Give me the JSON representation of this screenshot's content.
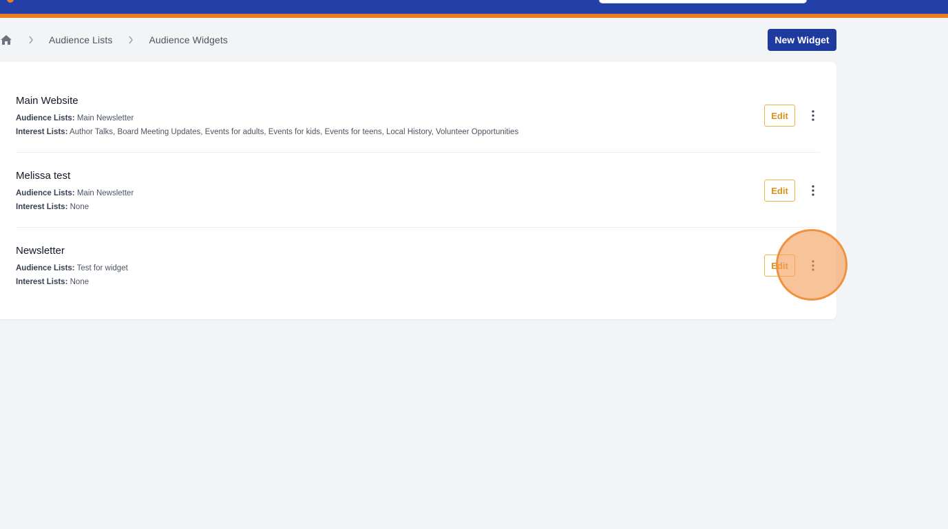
{
  "breadcrumb": {
    "items": [
      "Audience Lists",
      "Audience Widgets"
    ]
  },
  "header": {
    "new_widget_label": "New Widget"
  },
  "widgets": [
    {
      "name": "Main Website",
      "audience_label": "Audience Lists:",
      "audience_value": "Main Newsletter",
      "interest_label": "Interest Lists:",
      "interest_value": "Author Talks, Board Meeting Updates, Events for adults, Events for kids, Events for teens, Local History, Volunteer Opportunities",
      "edit_label": "Edit"
    },
    {
      "name": "Melissa test",
      "audience_label": "Audience Lists:",
      "audience_value": "Main Newsletter",
      "interest_label": "Interest Lists:",
      "interest_value": "None",
      "edit_label": "Edit"
    },
    {
      "name": "Newsletter",
      "audience_label": "Audience Lists:",
      "audience_value": "Test for widget",
      "interest_label": "Interest Lists:",
      "interest_value": "None",
      "edit_label": "Edit"
    }
  ],
  "colors": {
    "header_blue": "#233fa8",
    "accent_orange": "#e67e22",
    "primary_button": "#1e3a9e",
    "edit_border": "#f0b43c"
  },
  "icons": {
    "home": "home-icon",
    "separator": "chevron-right-icon",
    "more": "more-vertical-icon"
  }
}
